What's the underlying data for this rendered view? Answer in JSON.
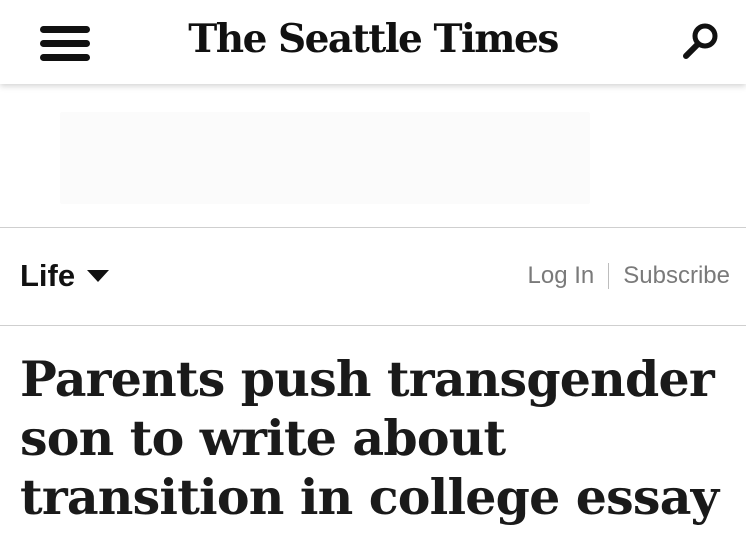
{
  "header": {
    "logo_text": "The Seattle Times"
  },
  "icons": {
    "menu": "hamburger-menu-icon",
    "search": "search-icon",
    "section_caret": "chevron-down-icon"
  },
  "section_nav": {
    "section_label": "Life"
  },
  "account": {
    "login_label": "Log In",
    "subscribe_label": "Subscribe"
  },
  "article": {
    "headline": "Parents push transgender son to write about transition in college essay"
  },
  "colors": {
    "text": "#1a1a1a",
    "muted_link": "#7a7a7a",
    "divider": "#cfcfcf",
    "background": "#ffffff"
  }
}
